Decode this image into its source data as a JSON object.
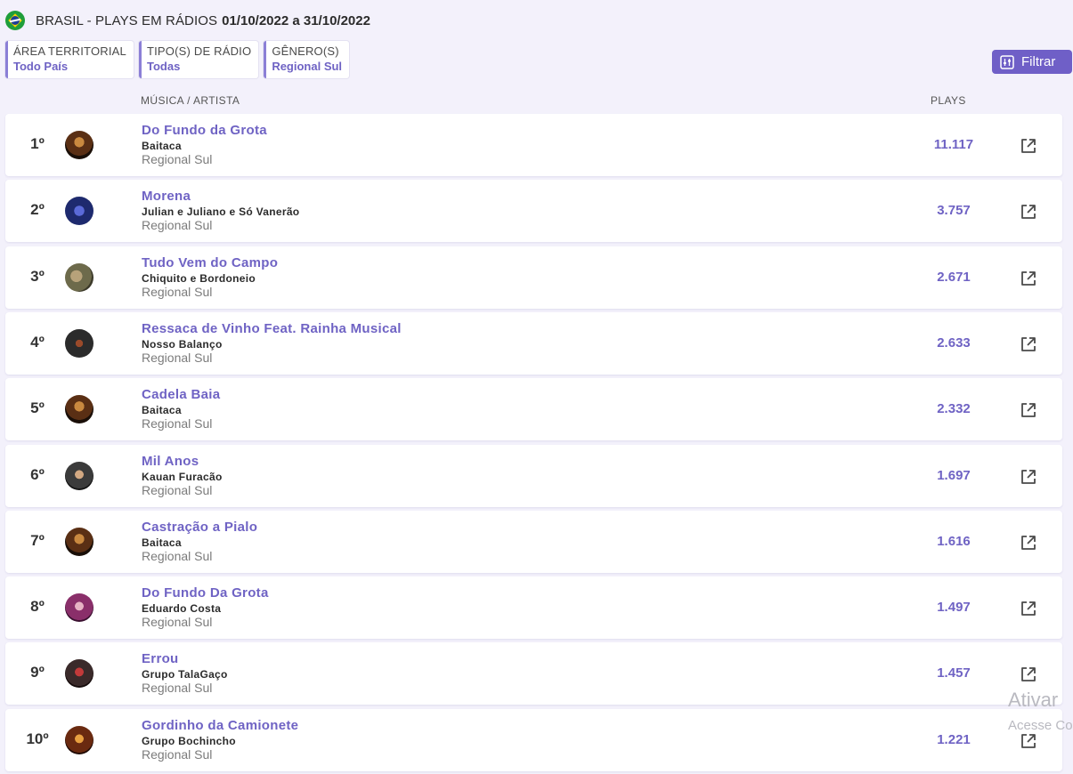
{
  "header": {
    "title": "BRASIL - PLAYS EM RÁDIOS",
    "dates": "01/10/2022 a 31/10/2022",
    "flag_icon": "brazil-flag-icon"
  },
  "filters": [
    {
      "label": "ÁREA TERRITORIAL",
      "value": "Todo País"
    },
    {
      "label": "TIPO(S) DE RÁDIO",
      "value": "Todas"
    },
    {
      "label": "GÊNERO(S)",
      "value": "Regional Sul"
    }
  ],
  "filter_button": {
    "label": "Filtrar",
    "icon": "sliders-icon"
  },
  "columns": {
    "song_artist": "MÚSICA / ARTISTA",
    "plays": "PLAYS"
  },
  "rows": [
    {
      "rank": "1º",
      "song": "Do Fundo da Grota",
      "artist": "Baitaca",
      "genre": "Regional Sul",
      "plays": "11.117"
    },
    {
      "rank": "2º",
      "song": "Morena",
      "artist": "Julian e Juliano e Só Vanerão",
      "genre": "Regional Sul",
      "plays": "3.757"
    },
    {
      "rank": "3º",
      "song": "Tudo Vem do Campo",
      "artist": "Chiquito e Bordoneio",
      "genre": "Regional Sul",
      "plays": "2.671"
    },
    {
      "rank": "4º",
      "song": "Ressaca de Vinho Feat. Rainha Musical",
      "artist": "Nosso Balanço",
      "genre": "Regional Sul",
      "plays": "2.633"
    },
    {
      "rank": "5º",
      "song": "Cadela Baia",
      "artist": "Baitaca",
      "genre": "Regional Sul",
      "plays": "2.332"
    },
    {
      "rank": "6º",
      "song": "Mil Anos",
      "artist": "Kauan Furacão",
      "genre": "Regional Sul",
      "plays": "1.697"
    },
    {
      "rank": "7º",
      "song": "Castração a Pialo",
      "artist": "Baitaca",
      "genre": "Regional Sul",
      "plays": "1.616"
    },
    {
      "rank": "8º",
      "song": "Do Fundo Da Grota",
      "artist": "Eduardo Costa",
      "genre": "Regional Sul",
      "plays": "1.497"
    },
    {
      "rank": "9º",
      "song": "Errou",
      "artist": "Grupo TalaGaço",
      "genre": "Regional Sul",
      "plays": "1.457"
    },
    {
      "rank": "10º",
      "song": "Gordinho da Camionete",
      "artist": "Grupo Bochincho",
      "genre": "Regional Sul",
      "plays": "1.221"
    }
  ],
  "row_icon": "external-link-icon",
  "watermark": {
    "line1": "Ativar",
    "line2": "Acesse Co"
  },
  "colors": {
    "accent": "#6f63c4",
    "button": "#6f5fc7",
    "background": "#f3f1fb"
  }
}
